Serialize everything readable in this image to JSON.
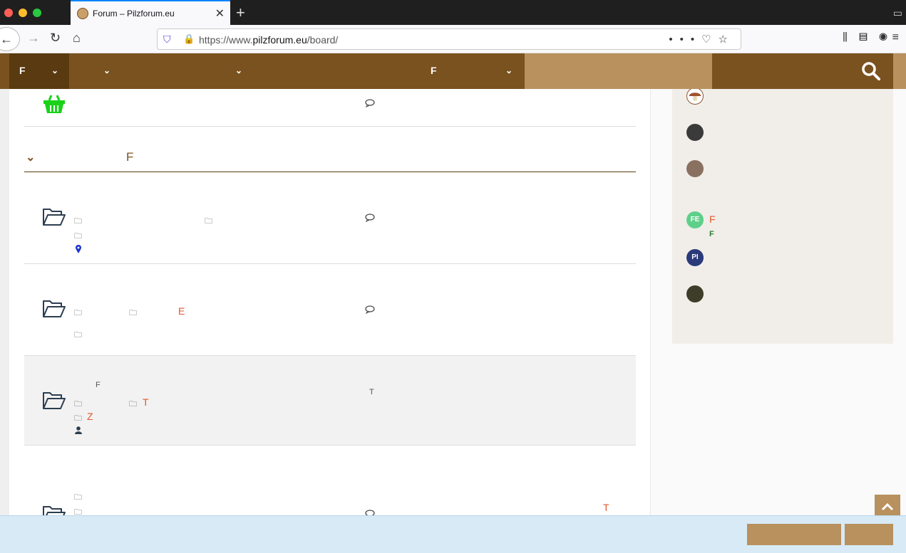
{
  "browser": {
    "tab_title": "Forum – Pilzforum.eu",
    "url_prefix": "https://www.",
    "url_domain": "pilzforum.eu",
    "url_path": "/board/"
  },
  "header": {
    "menu1": "F",
    "menu4": "F"
  },
  "category": {
    "title": "F"
  },
  "rows": {
    "row2_link": "E",
    "row3_label": "F",
    "row3_link": "T",
    "row3_link2": "Z",
    "row3_right": "T",
    "row4_right": "T"
  },
  "sidebar": {
    "user4_initials": "FE",
    "user4_name": "F",
    "user4_sub": "F",
    "user5_initials": "PI"
  },
  "colors": {
    "brand_dark": "#7a521f",
    "brand_light": "#b8915e",
    "link": "#e4572e"
  }
}
